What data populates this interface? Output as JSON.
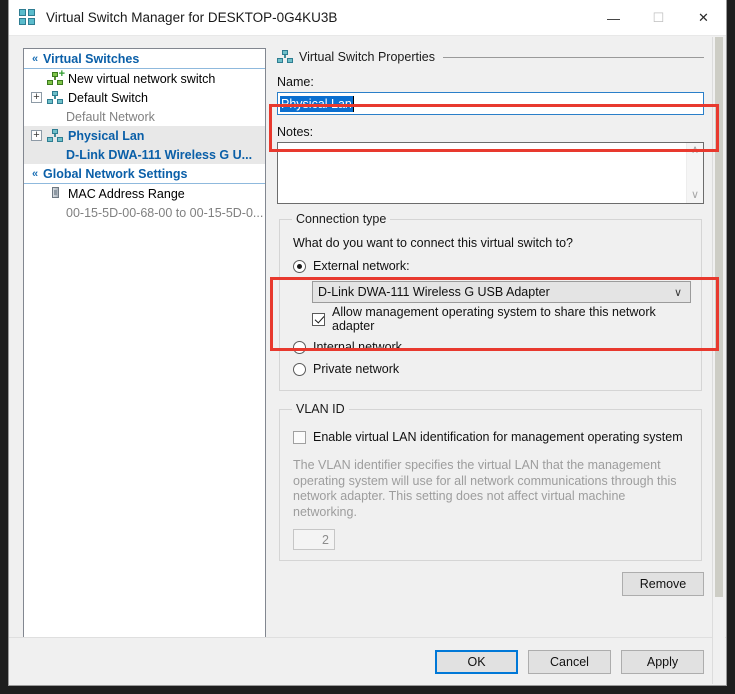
{
  "window": {
    "title": "Virtual Switch Manager for DESKTOP-0G4KU3B",
    "app_icon": "virtual-switch-manager-icon",
    "controls": {
      "minimize": "—",
      "maximize": "☐",
      "close": "✕"
    }
  },
  "tree": {
    "sections": [
      {
        "header": "Virtual Switches",
        "chevron": "«",
        "items": [
          {
            "label": "New virtual network switch",
            "icon": "new-virtual-switch-icon",
            "expander": false,
            "sub": null,
            "selected": false
          },
          {
            "label": "Default Switch",
            "icon": "virtual-switch-icon",
            "expander": true,
            "sub": "Default Network",
            "selected": false
          },
          {
            "label": "Physical Lan",
            "icon": "virtual-switch-icon",
            "expander": true,
            "sub": "D-Link DWA-111 Wireless G U...",
            "selected": true
          }
        ]
      },
      {
        "header": "Global Network Settings",
        "chevron": "«",
        "items": [
          {
            "label": "MAC Address Range",
            "icon": "mac-address-icon",
            "expander": false,
            "sub": "00-15-5D-00-68-00 to 00-15-5D-0...",
            "selected": false
          }
        ]
      }
    ]
  },
  "properties": {
    "section_title": "Virtual Switch Properties",
    "section_icon": "virtual-switch-icon",
    "name_label": "Name:",
    "name_value": "Physical Lan",
    "notes_label": "Notes:",
    "notes_value": "",
    "scroll_up_glyph": "∧",
    "scroll_down_glyph": "∨"
  },
  "connection_type": {
    "legend": "Connection type",
    "question": "What do you want to connect this virtual switch to?",
    "options": [
      {
        "label": "External network:",
        "selected": true
      },
      {
        "label": "Internal network",
        "selected": false
      },
      {
        "label": "Private network",
        "selected": false
      }
    ],
    "adapter_selected": "D-Link DWA-111 Wireless G USB Adapter",
    "adapter_arrow": "∨",
    "allow_management_label": "Allow management operating system to share this network adapter",
    "allow_management_checked": true
  },
  "vlan": {
    "legend": "VLAN ID",
    "enable_label": "Enable virtual LAN identification for management operating system",
    "enable_checked": false,
    "help_text": "The VLAN identifier specifies the virtual LAN that the management operating system will use for all network communications through this network adapter. This setting does not affect virtual machine networking.",
    "id_value": "2"
  },
  "buttons": {
    "remove": "Remove",
    "ok": "OK",
    "cancel": "Cancel",
    "apply": "Apply"
  },
  "colors": {
    "accent": "#0078d7",
    "annotation": "#e8392e",
    "tree_link": "#0a5fa8",
    "selection": "#0a6fd0"
  }
}
